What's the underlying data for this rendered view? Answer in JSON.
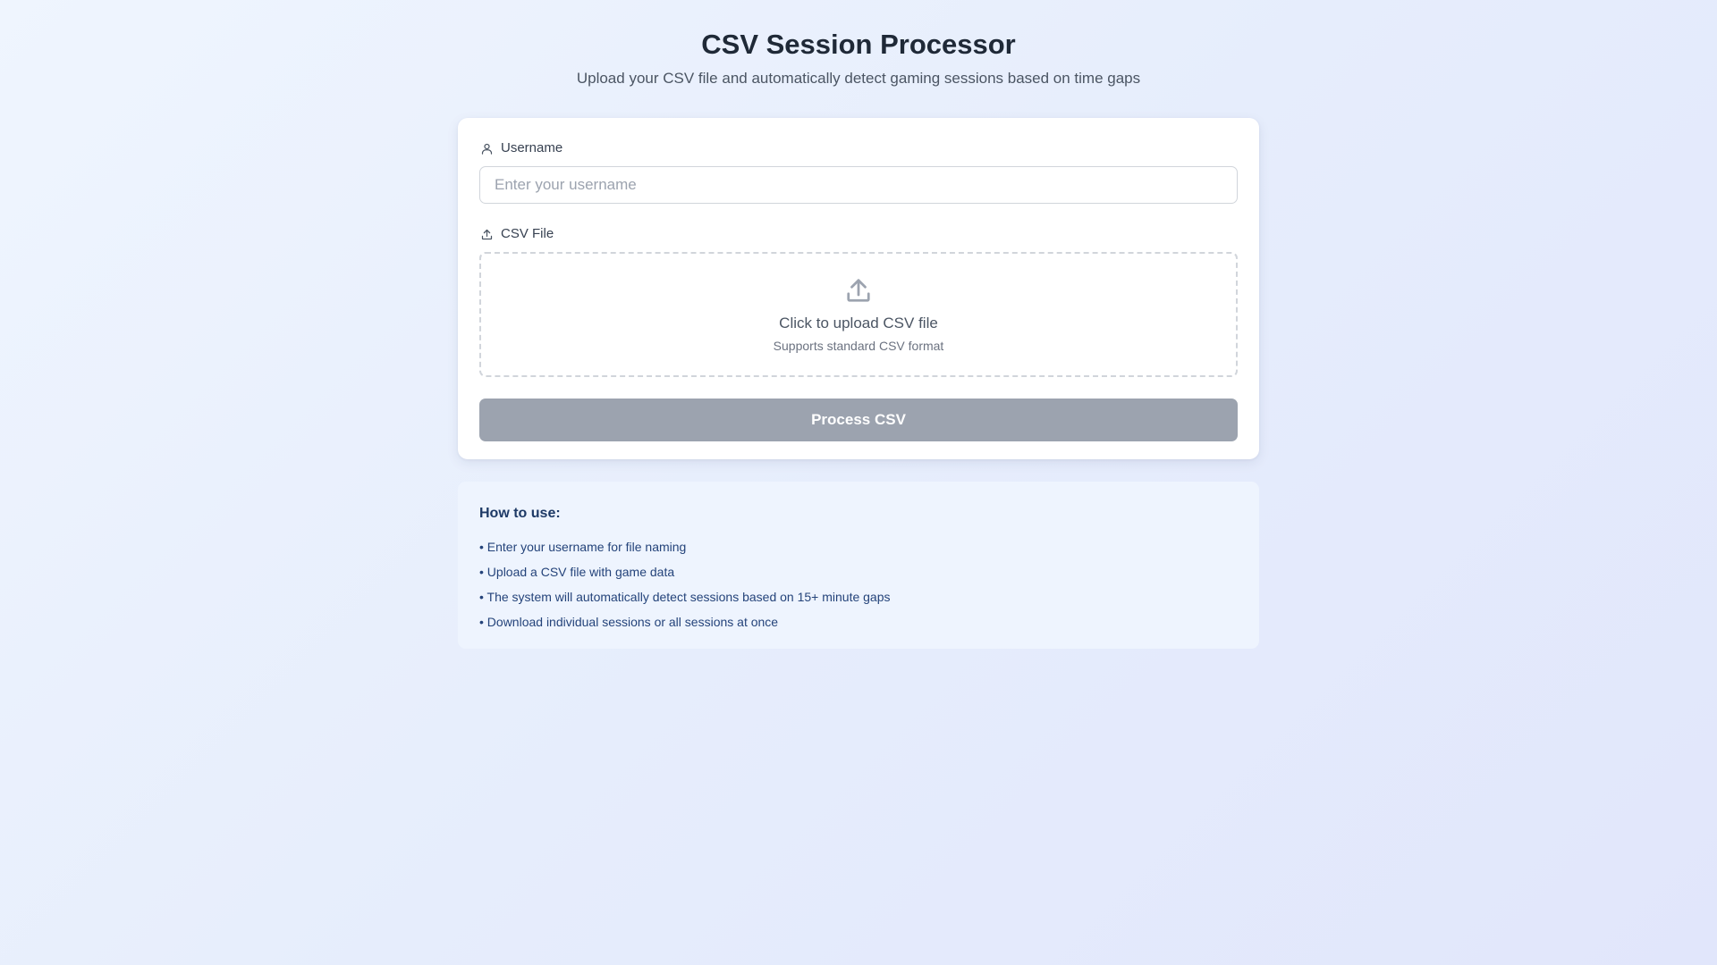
{
  "header": {
    "title": "CSV Session Processor",
    "subtitle": "Upload your CSV file and automatically detect gaming sessions based on time gaps"
  },
  "form": {
    "username": {
      "label": "Username",
      "icon": "user-icon",
      "value": "",
      "placeholder": "Enter your username"
    },
    "csv": {
      "label": "CSV File",
      "icon": "upload-icon",
      "dropzone_title": "Click to upload CSV file",
      "dropzone_hint": "Supports standard CSV format"
    },
    "submit_label": "Process CSV"
  },
  "howto": {
    "title": "How to use:",
    "items": [
      "• Enter your username for file naming",
      "• Upload a CSV file with game data",
      "• The system will automatically detect sessions based on 15+ minute gaps",
      "• Download individual sessions or all sessions at once"
    ]
  },
  "colors": {
    "background": "#e8eefc",
    "card": "#ffffff",
    "button_disabled": "#9ca3af",
    "howto_background": "#eef4fe",
    "howto_text": "#24437a"
  }
}
